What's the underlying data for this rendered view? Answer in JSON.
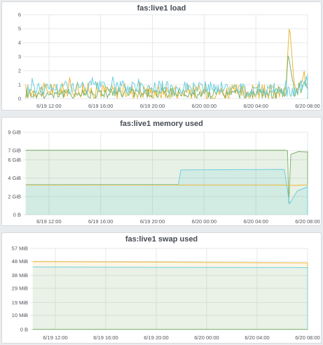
{
  "colors": {
    "green": "#7eb26d",
    "yellow": "#eab839",
    "cyan": "#6ed0e0",
    "orange": "#ef843c"
  },
  "chart_data": [
    {
      "type": "line",
      "title": "fas:live1 load",
      "x_ticks": [
        "6/19 12:00",
        "6/19 16:00",
        "6/19 20:00",
        "6/20 00:00",
        "6/20 04:00",
        "6/20 08:00"
      ],
      "y_ticks": [
        "0",
        "1",
        "2",
        "3",
        "4",
        "5",
        "6"
      ],
      "ylim": [
        0,
        6
      ],
      "x_range_hours": [
        -2,
        30
      ],
      "grid": true,
      "series": [
        {
          "color": "yellow",
          "baseline": 0.55,
          "noise": 0.55,
          "values": [
            [
              -1.8,
              0.5
            ],
            [
              2,
              0.6
            ],
            [
              5,
              0.5
            ],
            [
              12,
              0.45
            ],
            [
              18.3,
              0.4
            ],
            [
              18.6,
              5.4
            ],
            [
              19.0,
              0.5
            ],
            [
              20,
              1.3
            ],
            [
              21,
              1.8
            ],
            [
              21.5,
              0.6
            ],
            [
              24,
              0.4
            ],
            [
              29.8,
              0.35
            ]
          ]
        },
        {
          "color": "green",
          "baseline": 0.35,
          "noise": 0.35,
          "values": [
            [
              -1.8,
              0.3
            ],
            [
              8,
              0.35
            ],
            [
              18.3,
              0.3
            ],
            [
              18.5,
              3.2
            ],
            [
              19.0,
              0.4
            ],
            [
              20,
              0.9
            ],
            [
              21,
              1.2
            ],
            [
              22,
              0.3
            ],
            [
              29.8,
              0.3
            ]
          ]
        },
        {
          "color": "cyan",
          "baseline": 0.7,
          "noise": 0.45,
          "values": [
            [
              -1.8,
              0.7
            ],
            [
              6,
              0.8
            ],
            [
              12,
              0.75
            ],
            [
              18,
              0.6
            ],
            [
              19,
              0.5
            ],
            [
              20.5,
              1.3
            ],
            [
              21.2,
              1.0
            ],
            [
              22,
              0.6
            ],
            [
              29.8,
              0.55
            ]
          ]
        }
      ]
    },
    {
      "type": "area",
      "title": "fas:live1 memory used",
      "x_ticks": [
        "6/19 12:00",
        "6/19 16:00",
        "6/19 20:00",
        "6/20 00:00",
        "6/20 04:00",
        "6/20 08:00"
      ],
      "y_ticks": [
        "0 B",
        "2 GiB",
        "4 GiB",
        "6 GiB",
        "7 GiB",
        "9 GiB"
      ],
      "y_tick_values": [
        0,
        2,
        4,
        6,
        7,
        9
      ],
      "ylim": [
        0,
        9
      ],
      "x_range_hours": [
        -2,
        30
      ],
      "grid": true,
      "series": [
        {
          "color": "green",
          "fill": true,
          "fill_opacity": 0.18,
          "values": [
            [
              -1.8,
              7.05
            ],
            [
              18.2,
              7.05
            ],
            [
              18.45,
              7.0
            ],
            [
              18.55,
              1.3
            ],
            [
              18.7,
              6.6
            ],
            [
              19.3,
              6.9
            ],
            [
              20.5,
              6.85
            ],
            [
              23.5,
              6.9
            ],
            [
              23.55,
              0
            ],
            [
              23.65,
              6.85
            ],
            [
              29.8,
              6.95
            ]
          ]
        },
        {
          "color": "cyan",
          "fill": true,
          "fill_opacity": 0.18,
          "values": [
            [
              -1.8,
              3.3
            ],
            [
              10,
              3.32
            ],
            [
              10.2,
              4.9
            ],
            [
              18.2,
              4.95
            ],
            [
              18.4,
              3.1
            ],
            [
              18.6,
              1.2
            ],
            [
              19.2,
              2.6
            ],
            [
              20,
              3.05
            ],
            [
              21.5,
              3.2
            ],
            [
              22.8,
              3.25
            ],
            [
              22.85,
              0
            ],
            [
              22.95,
              3.3
            ],
            [
              29.8,
              3.35
            ]
          ]
        },
        {
          "color": "yellow",
          "fill": false,
          "values": [
            [
              -1.8,
              3.25
            ],
            [
              18.2,
              3.25
            ],
            [
              18.55,
              3.2
            ],
            [
              29.8,
              3.25
            ]
          ]
        }
      ]
    },
    {
      "type": "area",
      "title": "fas:live1 swap used",
      "x_ticks": [
        "6/19 12:00",
        "6/19 16:00",
        "6/19 20:00",
        "6/20 00:00",
        "6/20 04:00",
        "6/20 08:00"
      ],
      "y_ticks": [
        "0 B",
        "10 MiB",
        "19 MiB",
        "29 MiB",
        "38 MiB",
        "48 MiB",
        "57 MiB"
      ],
      "y_tick_values": [
        0,
        10,
        19,
        29,
        38,
        48,
        57
      ],
      "ylim": [
        0,
        57
      ],
      "x_range_hours": [
        -2,
        30
      ],
      "grid": true,
      "series": [
        {
          "color": "yellow",
          "fill": true,
          "fill_opacity": 0.12,
          "values": [
            [
              -1.8,
              47.8
            ],
            [
              10,
              47.3
            ],
            [
              20,
              46.8
            ],
            [
              25,
              46.4
            ],
            [
              29.6,
              46.0
            ],
            [
              29.65,
              0
            ],
            [
              29.8,
              0
            ]
          ]
        },
        {
          "color": "cyan",
          "fill": true,
          "fill_opacity": 0.12,
          "values": [
            [
              -1.8,
              44.0
            ],
            [
              10,
              43.7
            ],
            [
              18,
              43.6
            ],
            [
              22.8,
              43.5
            ],
            [
              22.85,
              0
            ],
            [
              22.95,
              43.4
            ],
            [
              29.8,
              43.3
            ]
          ]
        },
        {
          "color": "green",
          "fill": false,
          "values": [
            [
              -1.8,
              0.2
            ],
            [
              29.8,
              0.2
            ]
          ]
        }
      ]
    }
  ]
}
